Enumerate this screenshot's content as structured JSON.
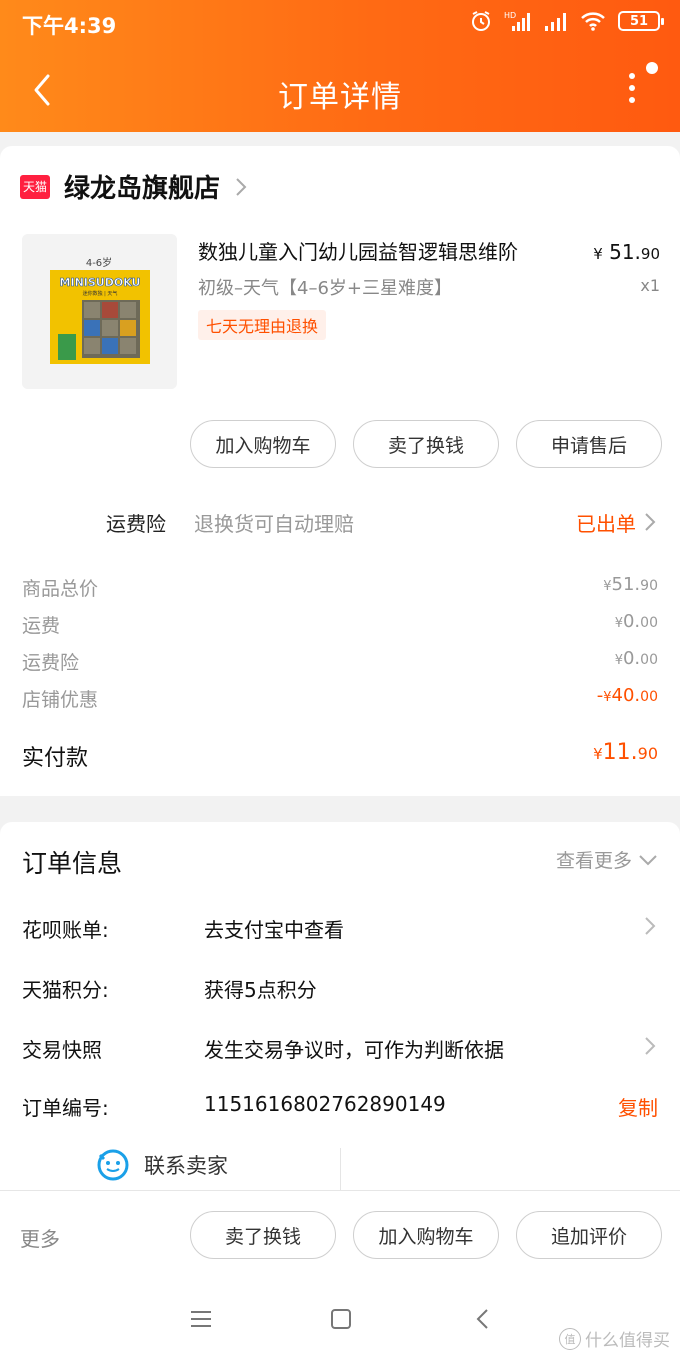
{
  "status_bar": {
    "time": "下午4:39",
    "battery": "51"
  },
  "header": {
    "title": "订单详情"
  },
  "shop": {
    "logo_text": "天猫",
    "name": "绿龙岛旗舰店"
  },
  "product": {
    "image_label_age": "4-6岁",
    "image_label_title": "MINISUDOKU",
    "image_label_sub": "迷你数独 | 天气",
    "name": "数独儿童入门幼儿园益智逻辑思维阶",
    "sku": "初级–天气【4–6岁+三星难度】",
    "tag": "七天无理由退换",
    "price_symbol": "¥",
    "price_int": "51.",
    "price_dec": "90",
    "quantity": "x1"
  },
  "item_actions": [
    "加入购物车",
    "卖了换钱",
    "申请售后"
  ],
  "insurance": {
    "label": "运费险",
    "desc": "退换货可自动理赔",
    "status": "已出单"
  },
  "fees": [
    {
      "label": "商品总价",
      "symbol": "¥",
      "int": "51.",
      "dec": "90",
      "prefix": ""
    },
    {
      "label": "运费",
      "symbol": "¥",
      "int": "0.",
      "dec": "00",
      "prefix": ""
    },
    {
      "label": "运费险",
      "symbol": "¥",
      "int": "0.",
      "dec": "00",
      "prefix": ""
    },
    {
      "label": "店铺优惠",
      "symbol": "¥",
      "int": "40.",
      "dec": "00",
      "prefix": "-"
    }
  ],
  "total": {
    "label": "实付款",
    "symbol": "¥",
    "int": "11.",
    "dec": "90"
  },
  "order_info": {
    "title": "订单信息",
    "view_more": "查看更多",
    "rows": [
      {
        "label": "花呗账单:",
        "value": "去支付宝中查看"
      },
      {
        "label": "天猫积分:",
        "value": "获得5点积分"
      },
      {
        "label": "交易快照",
        "value": "发生交易争议时，可作为判断依据"
      },
      {
        "label": "订单编号:",
        "value": "1151616802762890149"
      }
    ],
    "copy": "复制",
    "contact": "联系卖家"
  },
  "bottom_bar": {
    "more": "更多",
    "actions": [
      "卖了换钱",
      "加入购物车",
      "追加评价"
    ]
  },
  "watermark": {
    "badge": "值",
    "text": "什么值得买"
  },
  "colors": {
    "header_start": "#ff8a1a",
    "header_end": "#ff5a10",
    "accent": "#ff5000",
    "tmall_red": "#ff2040"
  }
}
